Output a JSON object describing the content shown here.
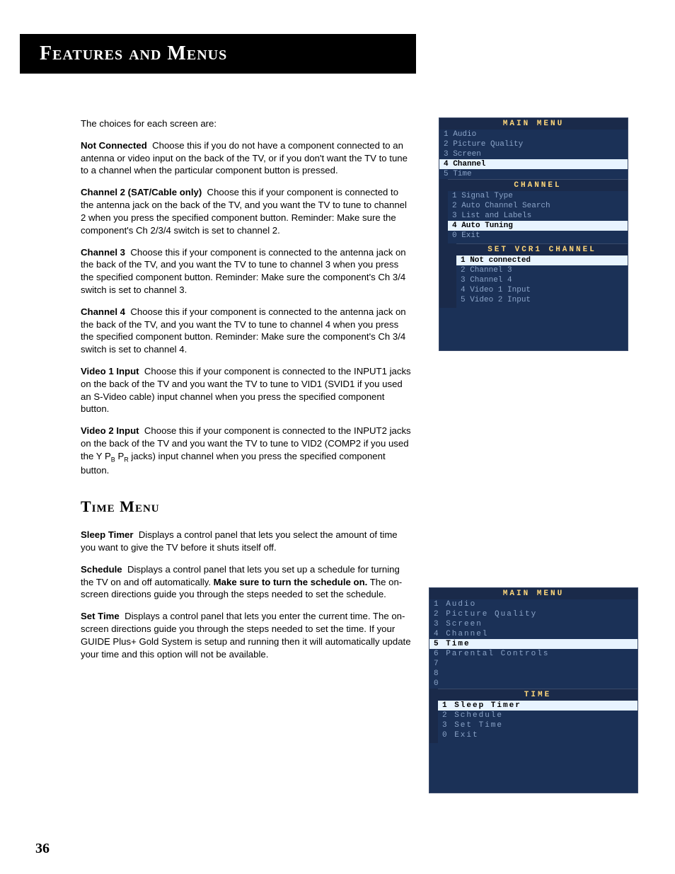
{
  "header": "Features and Menus",
  "pageNumber": "36",
  "intro": "The choices for each screen are:",
  "options": [
    {
      "label": "Not Connected",
      "text": "Choose this if you do not have a component connected to an antenna or video input on the back of the TV, or if you don't want the TV to tune to a channel when the particular component button is pressed."
    },
    {
      "label": "Channel 2 (SAT/Cable only)",
      "text": "Choose this if your component is connected to the antenna jack on the back of the TV, and you want the TV to tune to channel 2 when you press the specified component button. Reminder: Make sure the component's Ch 2/3/4 switch is set to channel 2."
    },
    {
      "label": "Channel 3",
      "text": "Choose this if your component is connected to the antenna jack on the back of the TV, and you want the TV to tune to channel 3 when you press the specified component button. Reminder: Make sure the component's Ch 3/4 switch is set to channel 3."
    },
    {
      "label": "Channel 4",
      "text": "Choose this if your component is connected to the antenna jack on the back of the TV, and you want the TV to tune to channel 4 when you press the specified component button. Reminder: Make sure the component's Ch 3/4 switch is set to channel 4."
    },
    {
      "label": "Video 1 Input",
      "text": "Choose this if your component is connected to the INPUT1 jacks on the back of the TV and you want the TV to tune to VID1 (SVID1 if you used an S-Video cable) input channel when you press the specified component button."
    }
  ],
  "video2": {
    "label": "Video 2 Input",
    "pre": "Choose this if your component is connected to the INPUT2 jacks on the back of the TV and you want the TV to tune to VID2 (COMP2 if you used the Y P",
    "sub1": "B",
    "mid": " P",
    "sub2": "R",
    "post": " jacks) input channel when you press the specified component button."
  },
  "timeMenuHeading": "Time Menu",
  "timeItems": {
    "sleep": {
      "label": "Sleep Timer",
      "text": "Displays a control panel that lets you select the amount of time you want to give the TV before it shuts itself off."
    },
    "schedule": {
      "label": "Schedule",
      "pre": "Displays a control panel that lets you set up a schedule for turning the TV on and off automatically. ",
      "bold": "Make sure to turn the schedule on.",
      "post": " The on-screen directions guide you through the steps needed to set the schedule."
    },
    "setTime": {
      "label": "Set Time",
      "text": "Displays a control panel that lets you enter the current time. The on-screen directions guide you through the steps needed to set the time. If your GUIDE Plus+ Gold System is setup and running then it will automatically update your time and this option will not be available."
    }
  },
  "osd1": {
    "title": "MAIN MENU",
    "items": [
      {
        "n": "1",
        "label": "Audio"
      },
      {
        "n": "2",
        "label": "Picture Quality"
      },
      {
        "n": "3",
        "label": "Screen"
      },
      {
        "n": "4",
        "label": "Channel",
        "sel": true
      },
      {
        "n": "5",
        "label": "Time"
      }
    ],
    "subTitle": "CHANNEL",
    "subItems": [
      {
        "n": "1",
        "label": "Signal Type"
      },
      {
        "n": "2",
        "label": "Auto Channel Search"
      },
      {
        "n": "3",
        "label": "List and Labels"
      },
      {
        "n": "4",
        "label": "Auto Tuning",
        "sel": true
      },
      {
        "n": "0",
        "label": "Exit"
      }
    ],
    "sub2Title": "SET VCR1 CHANNEL",
    "sub2Items": [
      {
        "n": "1",
        "label": "Not connected",
        "sel": true
      },
      {
        "n": "2",
        "label": "Channel 3"
      },
      {
        "n": "3",
        "label": "Channel 4"
      },
      {
        "n": "4",
        "label": "Video 1 Input"
      },
      {
        "n": "5",
        "label": "Video 2 Input"
      }
    ]
  },
  "osd2": {
    "title": "MAIN MENU",
    "items": [
      {
        "n": "1",
        "label": "Audio"
      },
      {
        "n": "2",
        "label": "Picture Quality"
      },
      {
        "n": "3",
        "label": "Screen"
      },
      {
        "n": "4",
        "label": "Channel"
      },
      {
        "n": "5",
        "label": "Time",
        "sel": true
      },
      {
        "n": "6",
        "label": "Parental Controls"
      },
      {
        "n": "7",
        "label": ""
      },
      {
        "n": "8",
        "label": ""
      },
      {
        "n": "0",
        "label": ""
      }
    ],
    "subTitle": "TIME",
    "subItems": [
      {
        "n": "1",
        "label": "Sleep Timer",
        "sel": true
      },
      {
        "n": "2",
        "label": "Schedule"
      },
      {
        "n": "3",
        "label": "Set Time"
      },
      {
        "n": "0",
        "label": "Exit"
      }
    ]
  }
}
